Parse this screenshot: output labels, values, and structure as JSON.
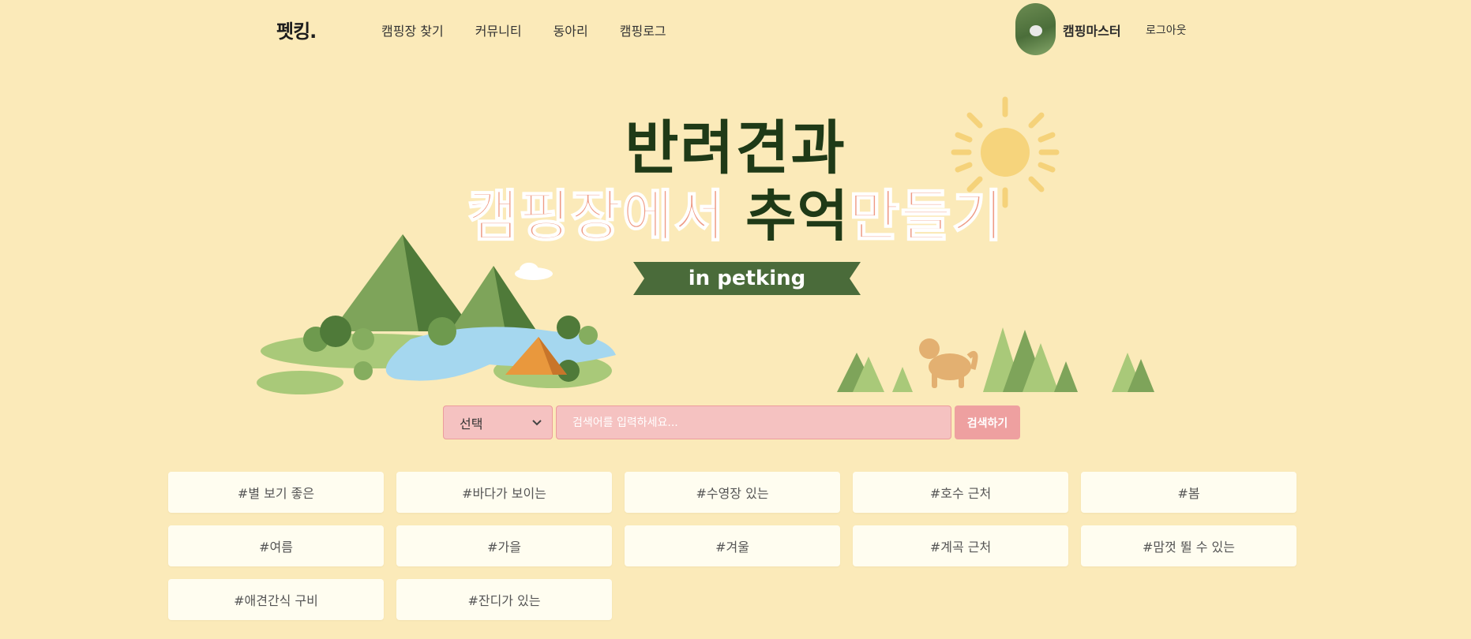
{
  "header": {
    "logo": "펫킹.",
    "nav": [
      "캠핑장 찾기",
      "커뮤니티",
      "동아리",
      "캠핑로그"
    ],
    "username": "캠핑마스터",
    "logout": "로그아웃"
  },
  "hero": {
    "title_line1": "반려견과",
    "title_line2_a": "캠핑장에서 ",
    "title_line2_b": "추억",
    "title_line2_c": "만들기",
    "ribbon": "in petking"
  },
  "search": {
    "select_value": "선택",
    "placeholder": "검색어를 입력하세요...",
    "button": "검색하기"
  },
  "tags": [
    "#별 보기 좋은",
    "#바다가 보이는",
    "#수영장 있는",
    "#호수 근처",
    "#봄",
    "#여름",
    "#가을",
    "#겨울",
    "#계곡 근처",
    "#맘껏 뛸 수 있는",
    "#애견간식 구비",
    "#잔디가 있는"
  ],
  "colors": {
    "background": "#fbeab9",
    "accent_pink": "#ee9a84",
    "dark_green": "#4a6b3a",
    "search_pink": "#f5c2c1"
  }
}
